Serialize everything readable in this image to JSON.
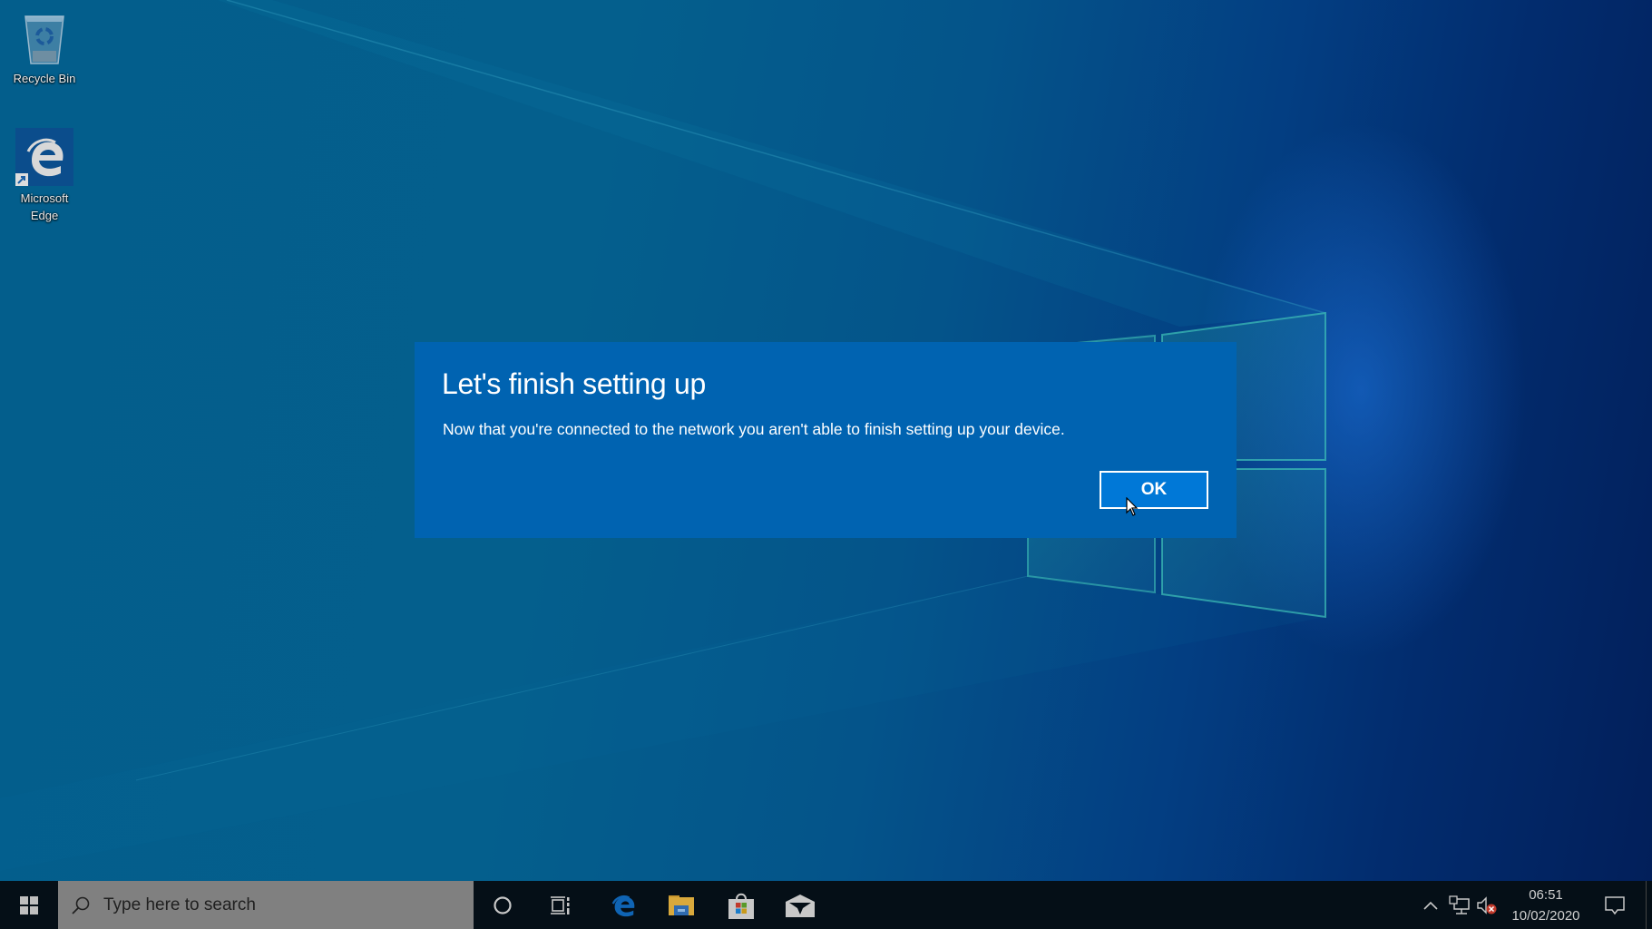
{
  "desktop": {
    "icons": [
      {
        "id": "recycle-bin",
        "label": "Recycle Bin",
        "icon": "recycle-bin-icon"
      },
      {
        "id": "microsoft-edge",
        "label_line1": "Microsoft",
        "label_line2": "Edge",
        "icon": "edge-icon",
        "shortcut": true
      }
    ]
  },
  "dialog": {
    "title": "Let's finish setting up",
    "body": "Now that you're connected to the network you aren't able to finish setting up your device.",
    "ok_label": "OK",
    "background_color": "#0063b1",
    "button_color": "#0078d7"
  },
  "taskbar": {
    "search_placeholder": "Type here to search",
    "pinned": [
      {
        "name": "cortana",
        "icon": "cortana-icon"
      },
      {
        "name": "task-view",
        "icon": "task-view-icon"
      },
      {
        "name": "microsoft-edge",
        "icon": "edge-icon"
      },
      {
        "name": "file-explorer",
        "icon": "folder-icon"
      },
      {
        "name": "microsoft-store",
        "icon": "store-icon"
      },
      {
        "name": "mail",
        "icon": "mail-icon"
      }
    ],
    "tray": {
      "time": "06:51",
      "date": "10/02/2020",
      "volume_status": "muted"
    }
  }
}
